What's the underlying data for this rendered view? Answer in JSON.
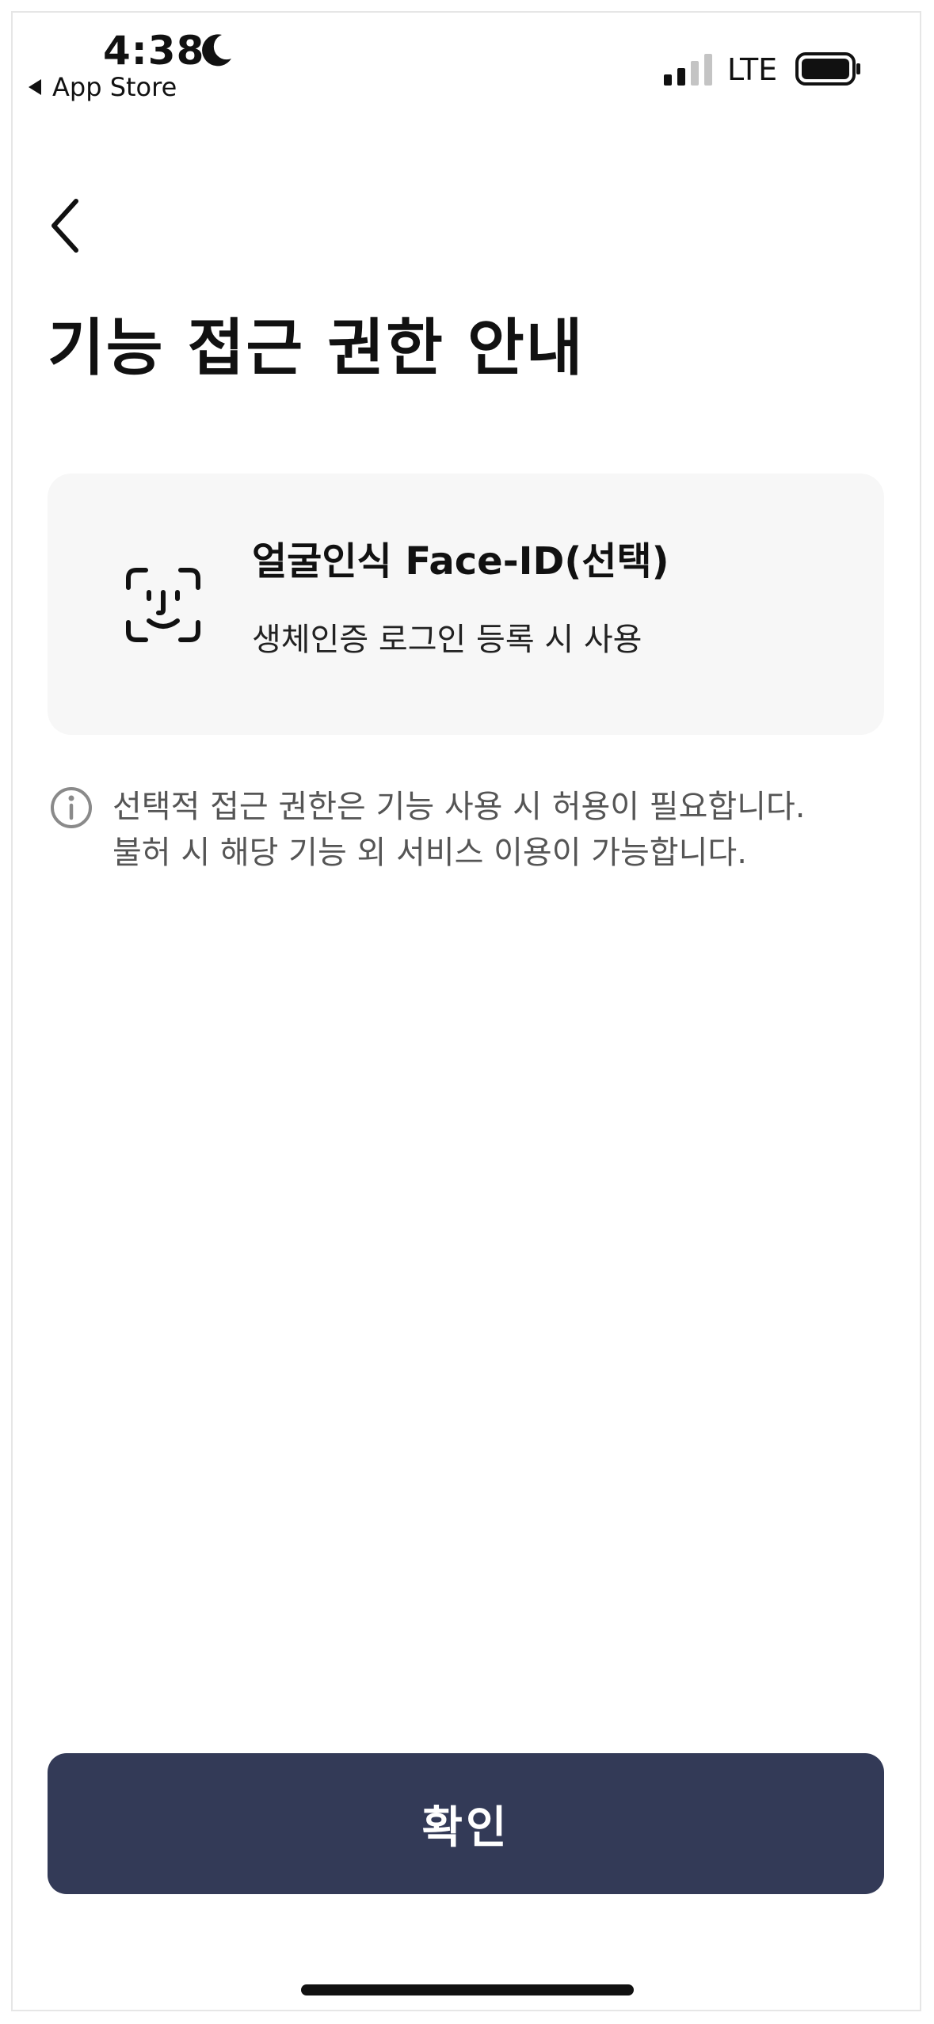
{
  "status_bar": {
    "time": "4:38",
    "back_app": "App Store",
    "network": "LTE"
  },
  "page": {
    "title": "기능 접근 권한 안내"
  },
  "permission": {
    "icon": "face-id-icon",
    "title": "얼굴인식 Face-ID(선택)",
    "description": "생체인증 로그인 등록 시 사용"
  },
  "notice": {
    "icon": "info-icon",
    "line1": "선택적 접근 권한은 기능 사용 시 허용이 필요합니다.",
    "line2": "불허 시 해당 기능 외 서비스 이용이 가능합니다."
  },
  "actions": {
    "confirm_label": "확인"
  },
  "colors": {
    "button_bg": "#333a57",
    "card_bg": "#f7f7f7",
    "notice_text": "#555555"
  }
}
